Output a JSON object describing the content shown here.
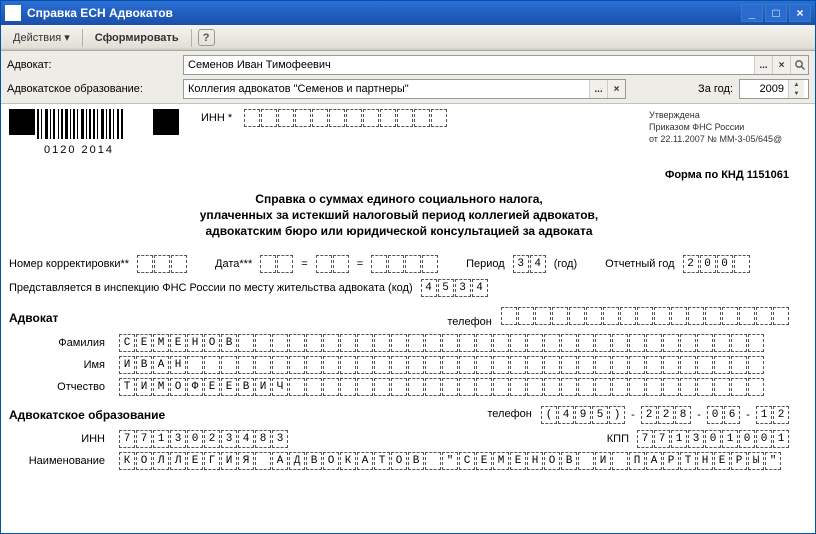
{
  "window": {
    "title": "Справка ЕСН Адвокатов"
  },
  "toolbar": {
    "actions": "Действия",
    "form": "Сформировать",
    "help": "?"
  },
  "filter": {
    "advocate_label": "Адвокат:",
    "advocate_value": "Семенов Иван Тимофеевич",
    "org_label": "Адвокатское образование:",
    "org_value": "Коллегия адвокатов \"Семенов и партнеры\"",
    "year_label": "За год:",
    "year_value": "2009"
  },
  "doc": {
    "barcode_num": "0120 2014",
    "inn_label": "ИНН *",
    "approved": {
      "l1": "Утверждена",
      "l2": "Приказом ФНС России",
      "l3": "от 22.11.2007 № ММ-3-05/645@"
    },
    "form_code": "Форма по КНД 1151061",
    "title1": "Справка о суммах единого социального налога,",
    "title2": "уплаченных за истекший налоговый период коллегией адвокатов,",
    "title3": "адвокатским бюро или юридической консультацией за адвоката",
    "corr_label": "Номер корректировки**",
    "date_label": "Дата***",
    "period_label": "Период",
    "period_cells": [
      "3",
      "4"
    ],
    "period_year": "(год)",
    "report_year_label": "Отчетный год",
    "report_year_cells": [
      "2",
      "0",
      "0",
      ""
    ],
    "fns_label": "Представляется в инспекцию ФНС России по месту жительства адвоката (код)",
    "fns_cells": [
      "4",
      "5",
      "3",
      "4"
    ],
    "advocate_section": "Адвокат",
    "phone_label": "телефон",
    "surname_label": "Фамилия",
    "surname_cells": [
      "С",
      "Е",
      "М",
      "Е",
      "Н",
      "О",
      "В"
    ],
    "name_label": "Имя",
    "name_cells": [
      "И",
      "В",
      "А",
      "Н"
    ],
    "patr_label": "Отчество",
    "patr_cells": [
      "Т",
      "И",
      "М",
      "О",
      "Ф",
      "Е",
      "Е",
      "В",
      "И",
      "Ч"
    ],
    "org_section": "Адвокатское образование",
    "org_phone_groups": [
      [
        "(",
        "4",
        "9",
        "5",
        ")"
      ],
      [
        "2",
        "2",
        "8"
      ],
      [
        "0",
        "6"
      ],
      [
        "1",
        "2"
      ]
    ],
    "inn_label2": "ИНН",
    "inn_cells": [
      "7",
      "7",
      "1",
      "3",
      "0",
      "2",
      "3",
      "4",
      "8",
      "3"
    ],
    "kpp_label": "КПП",
    "kpp_cells": [
      "7",
      "7",
      "1",
      "3",
      "0",
      "1",
      "0",
      "0",
      "1"
    ],
    "naim_label": "Наименование",
    "naim_cells": [
      "К",
      "О",
      "Л",
      "Л",
      "Е",
      "Г",
      "И",
      "Я",
      "",
      "А",
      "Д",
      "В",
      "О",
      "К",
      "А",
      "Т",
      "О",
      "В",
      "",
      "\"",
      "С",
      "Е",
      "М",
      "Е",
      "Н",
      "О",
      "В",
      "",
      "И",
      "",
      "П",
      "А",
      "Р",
      "Т",
      "Н",
      "Е",
      "Р",
      "Ы",
      "\""
    ]
  }
}
